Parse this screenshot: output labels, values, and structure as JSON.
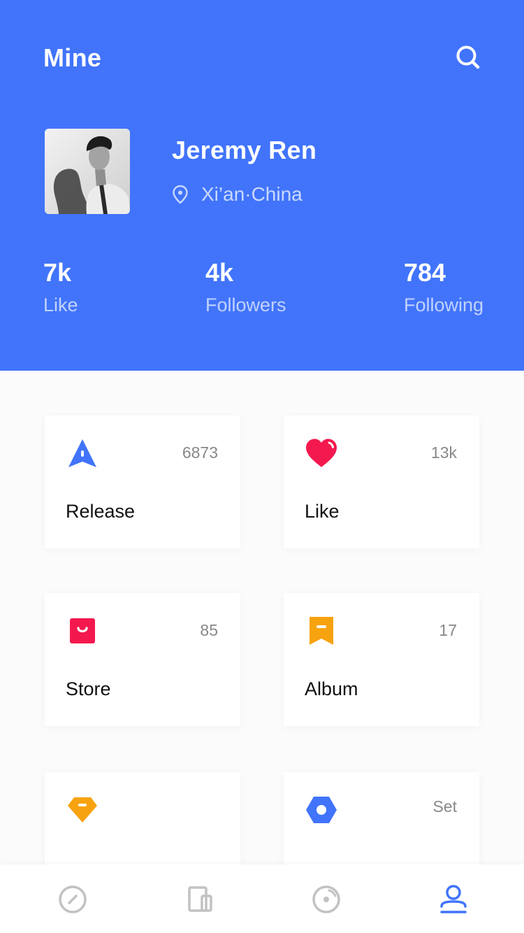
{
  "colors": {
    "header_bg": "#4174fb",
    "active_tab": "#4174fb",
    "inactive_tab": "#c2c2c2",
    "release_icon": "#4174fb",
    "like_icon": "#f3194e",
    "store_icon": "#f3194e",
    "album_icon": "#f7a310",
    "diamond_icon": "#f7a310",
    "set_icon": "#4174fb"
  },
  "header": {
    "title": "Mine",
    "search_icon": "search-icon"
  },
  "profile": {
    "name": "Jeremy Ren",
    "location": "Xi’an·China",
    "location_icon": "location-pin-icon"
  },
  "stats": [
    {
      "value": "7k",
      "label": "Like"
    },
    {
      "value": "4k",
      "label": "Followers"
    },
    {
      "value": "784",
      "label": "Following"
    }
  ],
  "cards": [
    {
      "label": "Release",
      "count": "6873",
      "icon": "release-icon"
    },
    {
      "label": "Like",
      "count": "13k",
      "icon": "heart-icon"
    },
    {
      "label": "Store",
      "count": "85",
      "icon": "store-bag-icon"
    },
    {
      "label": "Album",
      "count": "17",
      "icon": "bookmark-icon"
    },
    {
      "label": "",
      "count": "",
      "icon": "diamond-icon"
    },
    {
      "label": "",
      "count": "Set",
      "icon": "settings-hexagon-icon"
    }
  ],
  "tabbar": {
    "items": [
      {
        "icon": "compass-icon",
        "active": false
      },
      {
        "icon": "tablet-icon",
        "active": false
      },
      {
        "icon": "disc-icon",
        "active": false
      },
      {
        "icon": "user-icon",
        "active": true
      }
    ]
  }
}
